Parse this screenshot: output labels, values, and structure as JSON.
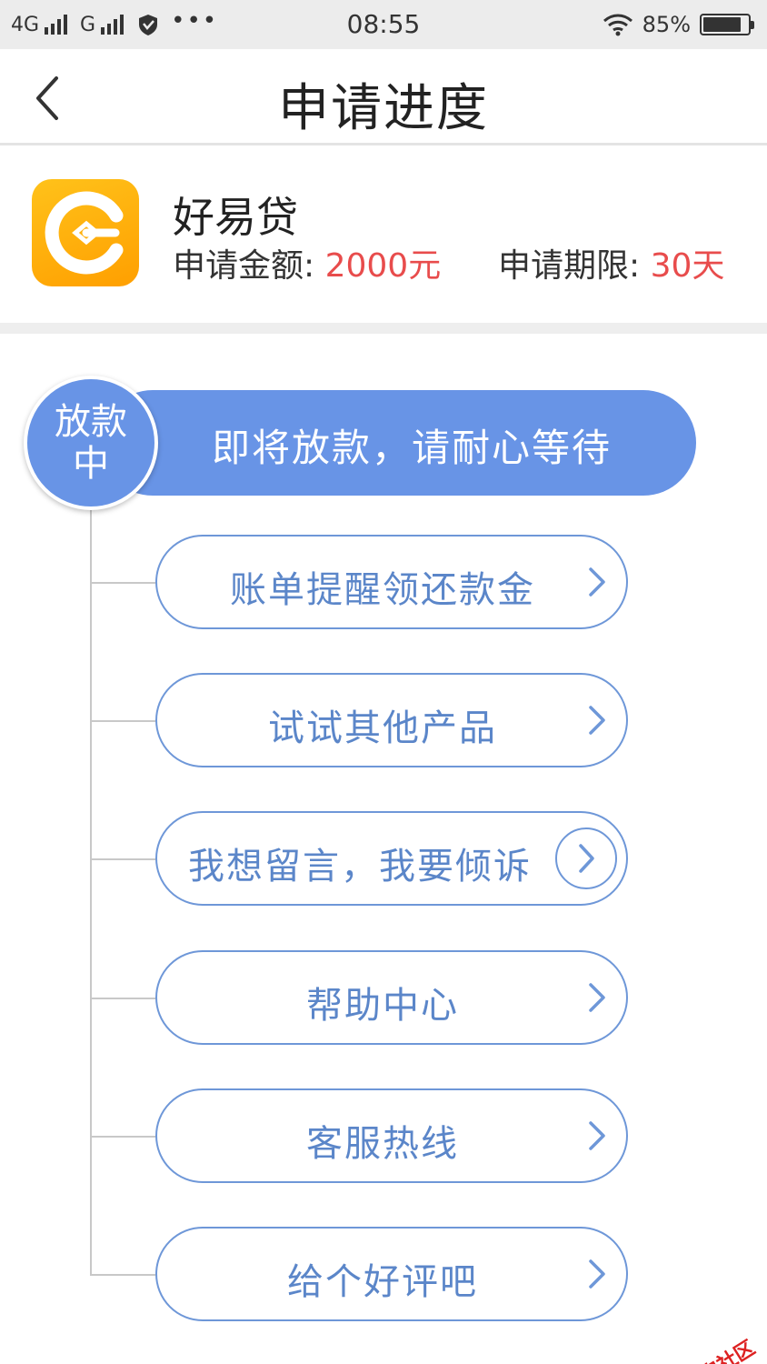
{
  "status_bar": {
    "network1": "4G",
    "network2": "G",
    "time": "08:55",
    "battery_text": "85%",
    "battery_level": 0.85,
    "icons": [
      "signal-icon",
      "shield-icon",
      "more-dots-icon",
      "wifi-icon",
      "battery-icon"
    ]
  },
  "header": {
    "title": "申请进度",
    "back_icon": "chevron-left-icon"
  },
  "product": {
    "name": "好易贷",
    "amount_label": "申请金额: ",
    "amount_value": "2000元",
    "period_label": "申请期限: ",
    "period_value": "30天",
    "accent_color": "#e84c4c"
  },
  "progress": {
    "stage_line1": "放款",
    "stage_line2": "中",
    "message": "即将放款，请耐心等待",
    "color": "#6894e6"
  },
  "actions": [
    {
      "label": "账单提醒领还款金"
    },
    {
      "label": "试试其他产品"
    },
    {
      "label": "我想留言，我要倾诉"
    },
    {
      "label": "帮助中心"
    },
    {
      "label": "客服热线"
    },
    {
      "label": "给个好评吧"
    }
  ],
  "watermark": {
    "text": "卡农社区"
  }
}
